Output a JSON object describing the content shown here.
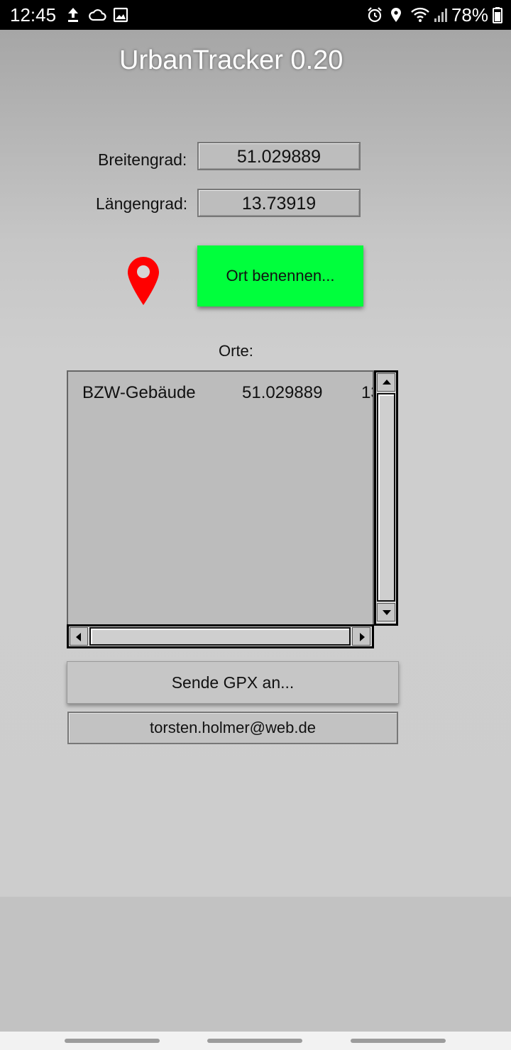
{
  "status_bar": {
    "time": "12:45",
    "left_icons": [
      "upload-icon",
      "cloud-icon",
      "image-icon"
    ],
    "right_icons": [
      "alarm-icon",
      "location-icon",
      "wifi-icon",
      "signal-icon",
      "battery-icon"
    ],
    "battery": "78%"
  },
  "app": {
    "title": "UrbanTracker 0.20",
    "latitude": {
      "label": "Breitengrad:",
      "value": "51.029889"
    },
    "longitude": {
      "label": "Längengrad:",
      "value": "13.73919"
    },
    "name_place_button": "Ort benennen...",
    "accent_color": "#00ff3c",
    "pin_color": "#ff0000",
    "places_label": "Orte:",
    "places": [
      {
        "name": "BZW-Gebäude",
        "lat": "51.029889",
        "lon": "13"
      }
    ],
    "send_gpx_button": "Sende GPX an...",
    "email": "torsten.holmer@web.de"
  }
}
